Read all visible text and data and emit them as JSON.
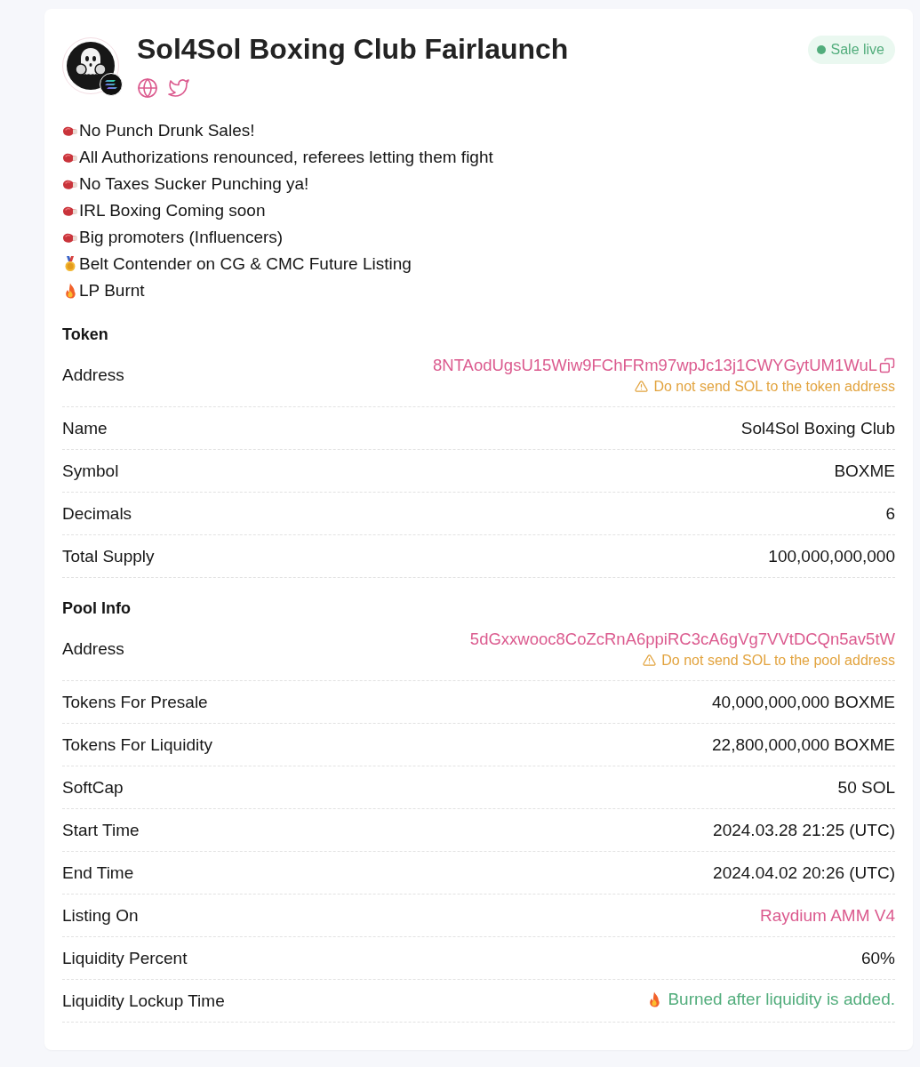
{
  "header": {
    "title": "Sol4Sol Boxing Club Fairlaunch",
    "status_badge": {
      "kind": "live",
      "label": "Sale live"
    }
  },
  "features": [
    {
      "kind": "glove",
      "text": "No Punch Drunk Sales!"
    },
    {
      "kind": "glove",
      "text": "All Authorizations renounced, referees letting them fight"
    },
    {
      "kind": "glove",
      "text": "No Taxes Sucker Punching ya!"
    },
    {
      "kind": "glove",
      "text": "IRL Boxing Coming soon"
    },
    {
      "kind": "glove",
      "text": "Big promoters (Influencers)"
    },
    {
      "kind": "medal",
      "text": "Belt Contender on CG & CMC Future Listing"
    },
    {
      "kind": "fire",
      "text": "LP Burnt"
    }
  ],
  "sections": [
    {
      "title": "Token",
      "rows": [
        {
          "label": "Address",
          "kind": "address",
          "value": "8NTAodUgsU15Wiw9FChFRm97wpJc13j1CWYGytUM1WuL",
          "copyable": true,
          "warning": "Do not send SOL to the token address"
        },
        {
          "label": "Name",
          "kind": "plain",
          "value": "Sol4Sol Boxing Club"
        },
        {
          "label": "Symbol",
          "kind": "plain",
          "value": "BOXME"
        },
        {
          "label": "Decimals",
          "kind": "plain",
          "value": "6"
        },
        {
          "label": "Total Supply",
          "kind": "plain",
          "value": "100,000,000,000"
        }
      ]
    },
    {
      "title": "Pool Info",
      "rows": [
        {
          "label": "Address",
          "kind": "address",
          "value": "5dGxxwooc8CoZcRnA6ppiRC3cA6gVg7VVtDCQn5av5tW",
          "copyable": false,
          "warning": "Do not send SOL to the pool address"
        },
        {
          "label": "Tokens For Presale",
          "kind": "plain",
          "value": "40,000,000,000 BOXME"
        },
        {
          "label": "Tokens For Liquidity",
          "kind": "plain",
          "value": "22,800,000,000 BOXME"
        },
        {
          "label": "SoftCap",
          "kind": "plain",
          "value": "50 SOL"
        },
        {
          "label": "Start Time",
          "kind": "plain",
          "value": "2024.03.28 21:25 (UTC)"
        },
        {
          "label": "End Time",
          "kind": "plain",
          "value": "2024.04.02 20:26 (UTC)"
        },
        {
          "label": "Listing On",
          "kind": "link",
          "value": "Raydium AMM V4"
        },
        {
          "label": "Liquidity Percent",
          "kind": "plain",
          "value": "60%"
        },
        {
          "label": "Liquidity Lockup Time",
          "kind": "burn",
          "value": "Burned after liquidity is added."
        }
      ]
    }
  ]
}
